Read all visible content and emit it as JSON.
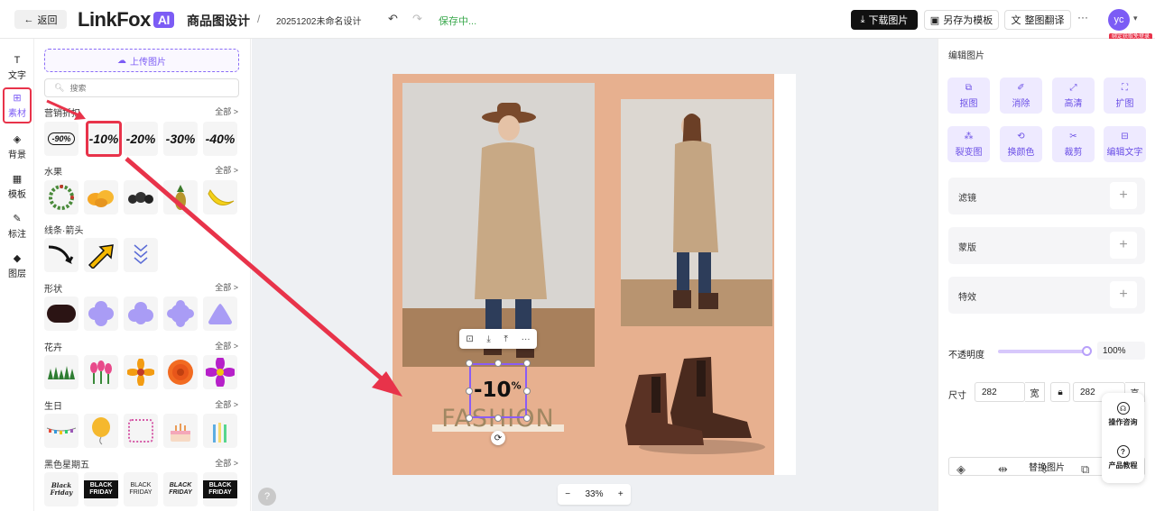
{
  "header": {
    "back_label": "返回",
    "logo_text": "LinkFox",
    "logo_badge": "AI",
    "app_title": "商品图设计",
    "separator": "/",
    "doc_name": "20251202未命名设计",
    "save_status": "保存中...",
    "download_label": "下载图片",
    "save_template_label": "另存为模板",
    "translate_label": "整图翻译",
    "more_label": "···",
    "avatar_text": "yc",
    "avatar_badge": "绑定获取免登录"
  },
  "rail": {
    "items": [
      {
        "label": "文字",
        "icon": "T"
      },
      {
        "label": "素材",
        "icon": "⊞"
      },
      {
        "label": "背景",
        "icon": "◈"
      },
      {
        "label": "模板",
        "icon": "▦"
      },
      {
        "label": "标注",
        "icon": "✎"
      },
      {
        "label": "图层",
        "icon": "◆"
      }
    ],
    "active_index": 1
  },
  "panel": {
    "upload_label": "上传图片",
    "search_placeholder": "搜索",
    "categories": [
      {
        "title": "营销折扣",
        "more": "全部 >",
        "items": [
          "-90%",
          "-10%",
          "-20%",
          "-30%",
          "-40%"
        ]
      },
      {
        "title": "水果",
        "more": "全部 >"
      },
      {
        "title": "线条·箭头",
        "more": ""
      },
      {
        "title": "形状",
        "more": "全部 >"
      },
      {
        "title": "花卉",
        "more": "全部 >"
      },
      {
        "title": "生日",
        "more": "全部 >"
      },
      {
        "title": "黑色星期五",
        "more": "全部 >",
        "items": [
          "Black Friday",
          "BLACK FRIDAY",
          "BLACK FRIDAY",
          "BLACK FRIDAY",
          "BLACK FRIDAY"
        ]
      }
    ]
  },
  "canvas": {
    "discount_text": "-10",
    "discount_sup": "%",
    "fashion_text": "FASHION",
    "zoom_level": "33%",
    "zoom_out": "−",
    "zoom_in": "+",
    "help": "?",
    "float_toolbar": [
      "⊡",
      "⤓",
      "⤒",
      "···"
    ]
  },
  "right_panel": {
    "title": "编辑图片",
    "tools": [
      {
        "label": "抠图",
        "icon": "⧉"
      },
      {
        "label": "消除",
        "icon": "✐"
      },
      {
        "label": "高清",
        "icon": "⤢"
      },
      {
        "label": "扩图",
        "icon": "⛶"
      },
      {
        "label": "裂变图",
        "icon": "⁂"
      },
      {
        "label": "换颜色",
        "icon": "⟲"
      },
      {
        "label": "裁剪",
        "icon": "✂"
      },
      {
        "label": "编辑文字",
        "icon": "⊟"
      }
    ],
    "rows": [
      {
        "label": "滤镜",
        "plus": "+"
      },
      {
        "label": "蒙版",
        "plus": "+"
      },
      {
        "label": "特效",
        "plus": "+"
      }
    ],
    "opacity_label": "不透明度",
    "opacity_value": "100%",
    "opacity_level": 1.0,
    "size_label": "尺寸",
    "width_value": "282",
    "width_unit": "宽",
    "height_value": "282",
    "height_unit": "高",
    "replace_label": "替换图片",
    "help_items": [
      "操作咨询",
      "产品教程"
    ]
  },
  "colors": {
    "accent": "#7c5cf5",
    "highlight": "#e8334a",
    "canvas_bg": "#e7b08f"
  }
}
